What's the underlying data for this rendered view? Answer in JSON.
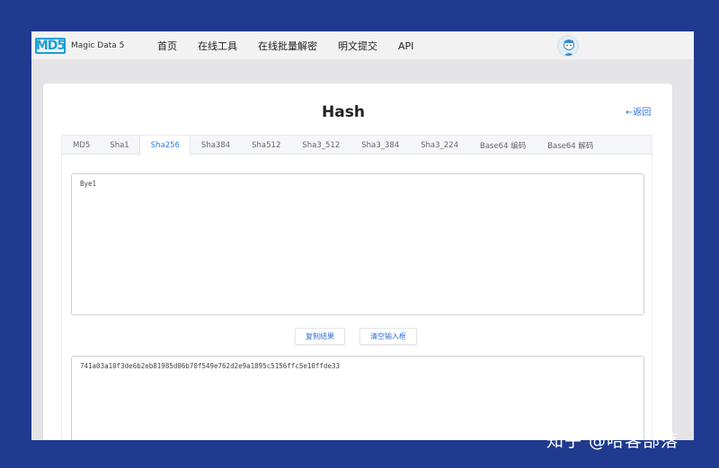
{
  "navbar": {
    "logo_mark": "MD5",
    "logo_text": "Magic Data 5",
    "items": [
      "首页",
      "在线工具",
      "在线批量解密",
      "明文提交",
      "API"
    ]
  },
  "page": {
    "title": "Hash",
    "back_label": "←返回"
  },
  "tabs": [
    {
      "label": "MD5"
    },
    {
      "label": "Sha1"
    },
    {
      "label": "Sha256",
      "active": true
    },
    {
      "label": "Sha384"
    },
    {
      "label": "Sha512"
    },
    {
      "label": "Sha3_512"
    },
    {
      "label": "Sha3_384"
    },
    {
      "label": "Sha3_224"
    },
    {
      "label": "Base64 编码"
    },
    {
      "label": "Base64 解码"
    }
  ],
  "input": {
    "value": "Bye1"
  },
  "buttons": {
    "copy_label": "复制结果",
    "clear_label": "清空输入框"
  },
  "output": {
    "value": "741a03a10f3de6b2eb81985d06b70f549e762d2e9a1895c5156ffc5e10ffde33"
  },
  "watermark": "知乎 @哈客部落",
  "colors": {
    "background": "#1f3a8e",
    "accent": "#2f7ee0",
    "link": "#2f6fd8"
  }
}
